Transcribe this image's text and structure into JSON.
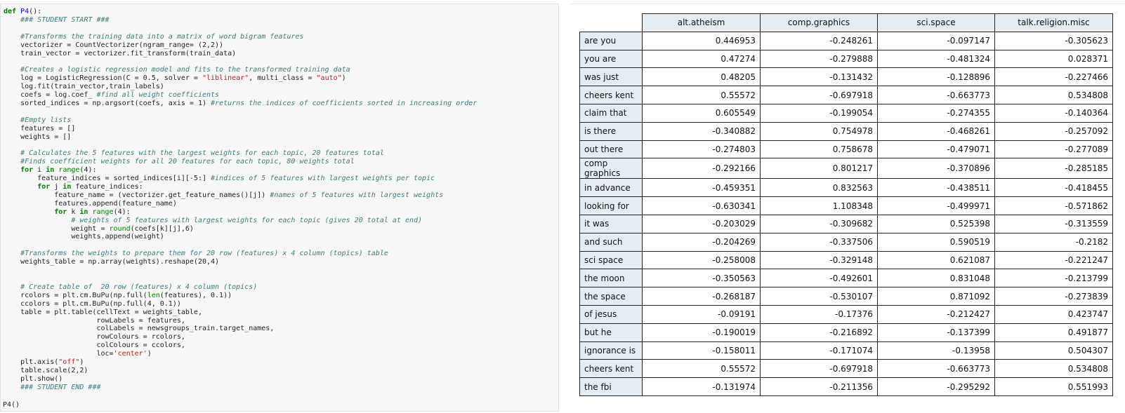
{
  "code": {
    "lines": [
      "def P4():",
      "    ### STUDENT START ###",
      "",
      "    #Transforms the training data into a matrix of word bigram features",
      "    vectorizer = CountVectorizer(ngram_range= (2,2))",
      "    train_vector = vectorizer.fit_transform(train_data)",
      "",
      "    #Creates a logistic regression model and fits to the transformed training data",
      "    log = LogisticRegression(C = 0.5, solver = \"liblinear\", multi_class = \"auto\")",
      "    log.fit(train_vector,train_labels)",
      "    coefs = log.coef_ #find all weight coefficients",
      "    sorted_indices = np.argsort(coefs, axis = 1) #returns the indices of coefficients sorted in increasing order",
      "",
      "    #Empty lists",
      "    features = []",
      "    weights = []",
      "",
      "    # Calculates the 5 features with the largest weights for each topic, 20 features total",
      "    #Finds coefficient weights for all 20 features for each topic, 80 weights total",
      "    for i in range(4):",
      "        feature_indices = sorted_indices[i][-5:] #indices of 5 features with largest weights per topic",
      "        for j in feature_indices:",
      "            feature_name = (vectorizer.get_feature_names()[j]) #names of 5 features with largest weights",
      "            features.append(feature_name)",
      "            for k in range(4):",
      "                # weights of 5 features with largest weights for each topic (gives 20 total at end)",
      "                weight = round(coefs[k][j],6)",
      "                weights.append(weight)",
      "",
      "    #Transforms the weights to prepare them for 20 row (features) x 4 column (topics) table",
      "    weights_table = np.array(weights).reshape(20,4)",
      "",
      "",
      "    # Create table of  20 row (features) x 4 column (topics)",
      "    rcolors = plt.cm.BuPu(np.full(len(features), 0.1))",
      "    ccolors = plt.cm.BuPu(np.full(4, 0.1))",
      "    table = plt.table(cellText = weights_table,",
      "                      rowLabels = features,",
      "                      colLabels = newsgroups_train.target_names,",
      "                      rowColours = rcolors,",
      "                      colColours = ccolors,",
      "                      loc='center')",
      "    plt.axis(\"off\")",
      "    table.scale(2,2)",
      "    plt.show()",
      "    ### STUDENT END ###"
    ],
    "call": "P4()"
  },
  "table": {
    "columns": [
      "alt.atheism",
      "comp.graphics",
      "sci.space",
      "talk.religion.misc"
    ],
    "rows": [
      {
        "label": "are you",
        "values": [
          "0.446953",
          "-0.248261",
          "-0.097147",
          "-0.305623"
        ]
      },
      {
        "label": "you are",
        "values": [
          "0.47274",
          "-0.279888",
          "-0.481324",
          "0.028371"
        ]
      },
      {
        "label": "was just",
        "values": [
          "0.48205",
          "-0.131432",
          "-0.128896",
          "-0.227466"
        ]
      },
      {
        "label": "cheers kent",
        "values": [
          "0.55572",
          "-0.697918",
          "-0.663773",
          "0.534808"
        ]
      },
      {
        "label": "claim that",
        "values": [
          "0.605549",
          "-0.199054",
          "-0.274355",
          "-0.140364"
        ]
      },
      {
        "label": "is there",
        "values": [
          "-0.340882",
          "0.754978",
          "-0.468261",
          "-0.257092"
        ]
      },
      {
        "label": "out there",
        "values": [
          "-0.274803",
          "0.758678",
          "-0.479071",
          "-0.277089"
        ]
      },
      {
        "label": "comp graphics",
        "values": [
          "-0.292166",
          "0.801217",
          "-0.370896",
          "-0.285185"
        ]
      },
      {
        "label": "in advance",
        "values": [
          "-0.459351",
          "0.832563",
          "-0.438511",
          "-0.418455"
        ]
      },
      {
        "label": "looking for",
        "values": [
          "-0.630341",
          "1.108348",
          "-0.499971",
          "-0.571862"
        ]
      },
      {
        "label": "it was",
        "values": [
          "-0.203029",
          "-0.309682",
          "0.525398",
          "-0.313559"
        ]
      },
      {
        "label": "and such",
        "values": [
          "-0.204269",
          "-0.337506",
          "0.590519",
          "-0.2182"
        ]
      },
      {
        "label": "sci space",
        "values": [
          "-0.258008",
          "-0.329148",
          "0.621087",
          "-0.221247"
        ]
      },
      {
        "label": "the moon",
        "values": [
          "-0.350563",
          "-0.492601",
          "0.831048",
          "-0.213799"
        ]
      },
      {
        "label": "the space",
        "values": [
          "-0.268187",
          "-0.530107",
          "0.871092",
          "-0.273839"
        ]
      },
      {
        "label": "of jesus",
        "values": [
          "-0.09191",
          "-0.17376",
          "-0.212427",
          "0.423747"
        ]
      },
      {
        "label": "but he",
        "values": [
          "-0.190019",
          "-0.216892",
          "-0.137399",
          "0.491877"
        ]
      },
      {
        "label": "ignorance is",
        "values": [
          "-0.158011",
          "-0.171074",
          "-0.13958",
          "0.504307"
        ]
      },
      {
        "label": "cheers kent",
        "values": [
          "0.55572",
          "-0.697918",
          "-0.663773",
          "0.534808"
        ]
      },
      {
        "label": "the fbi",
        "values": [
          "-0.131974",
          "-0.211356",
          "-0.295292",
          "0.551993"
        ]
      }
    ]
  },
  "colors": {
    "header_fill": "#e4ecf4",
    "code_bg": "#f7f7f7",
    "keyword": "#008000",
    "comment": "#3d7b7b",
    "string": "#ba2121"
  }
}
